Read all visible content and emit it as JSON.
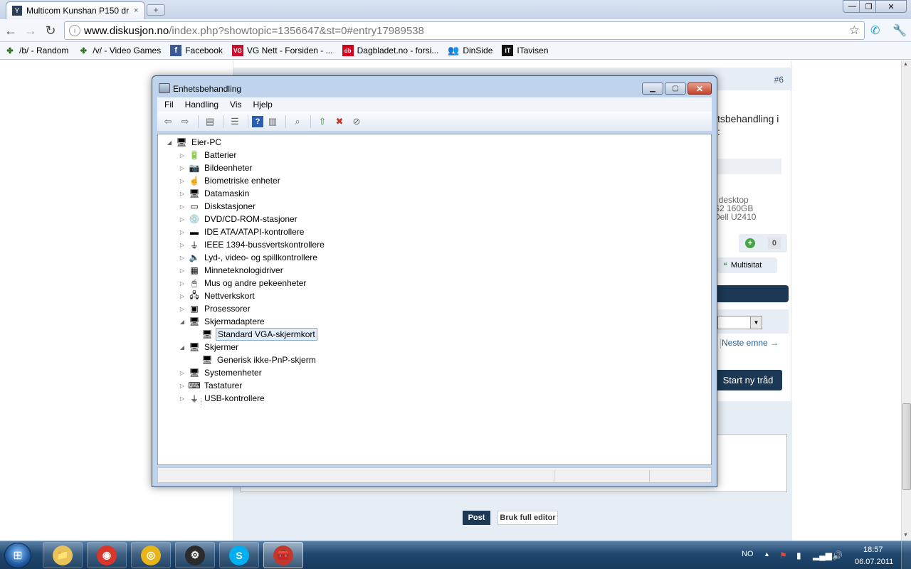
{
  "browser": {
    "tab": {
      "title": "Multicom Kunshan P150 dr",
      "close": "×"
    },
    "new_tab": "+",
    "window_controls": {
      "min": "—",
      "max": "❐",
      "close": "✕"
    },
    "nav": {
      "back": "←",
      "forward": "→",
      "reload": "↻"
    },
    "url": {
      "host": "www.diskusjon.no",
      "path": "/index.php?showtopic=1356647&st=0#entry17989538"
    },
    "bookmarks": [
      {
        "label": "/b/ - Random",
        "icon": "clover-icon",
        "color": "#2e6b1e"
      },
      {
        "label": "/v/ - Video Games",
        "icon": "clover-icon",
        "color": "#2e6b1e"
      },
      {
        "label": "Facebook",
        "icon": "facebook-icon",
        "color": "#3b5998"
      },
      {
        "label": "VG Nett - Forsiden - ...",
        "icon": "vg-icon",
        "color": "#c8102e"
      },
      {
        "label": "Dagbladet.no - forsi...",
        "icon": "db-icon",
        "color": "#d6001c"
      },
      {
        "label": "DinSide",
        "icon": "dinside-icon",
        "color": "#2266aa"
      },
      {
        "label": "ITavisen",
        "icon": "itavisen-icon",
        "color": "#111111"
      }
    ]
  },
  "forum": {
    "post_number": "#6",
    "post_text_line1": "tsbehandling i",
    "post_text_line2": ":",
    "specs": [
      ", desktop",
      "S2 160GB",
      "Dell U2410"
    ],
    "rep_count": "0",
    "multiquote_label": "Multisitat",
    "next_topic": "Neste emne →",
    "start_thread": "Start ny tråd",
    "post_button": "Post",
    "full_editor_button": "Bruk full editor"
  },
  "device_manager": {
    "title": "Enhetsbehandling",
    "menus": [
      "Fil",
      "Handling",
      "Vis",
      "Hjelp"
    ],
    "root": "Eier-PC",
    "categories": [
      {
        "label": "Batterier",
        "icon": "battery-icon",
        "glyph": "🔋"
      },
      {
        "label": "Bildeenheter",
        "icon": "camera-icon",
        "glyph": "📷"
      },
      {
        "label": "Biometriske enheter",
        "icon": "fingerprint-icon",
        "glyph": "☝"
      },
      {
        "label": "Datamaskin",
        "icon": "computer-icon",
        "glyph": "🖥"
      },
      {
        "label": "Diskstasjoner",
        "icon": "disk-drive-icon",
        "glyph": "▭"
      },
      {
        "label": "DVD/CD-ROM-stasjoner",
        "icon": "dvd-drive-icon",
        "glyph": "💿"
      },
      {
        "label": "IDE ATA/ATAPI-kontrollere",
        "icon": "ide-controller-icon",
        "glyph": "▬"
      },
      {
        "label": "IEEE 1394-bussvertskontrollere",
        "icon": "firewire-icon",
        "glyph": "⏚"
      },
      {
        "label": "Lyd-, video- og spillkontrollere",
        "icon": "speaker-icon",
        "glyph": "🔈"
      },
      {
        "label": "Minneteknologidriver",
        "icon": "memory-icon",
        "glyph": "▦"
      },
      {
        "label": "Mus og andre pekeenheter",
        "icon": "mouse-icon",
        "glyph": "🖱"
      },
      {
        "label": "Nettverkskort",
        "icon": "network-icon",
        "glyph": "🖧"
      },
      {
        "label": "Prosessorer",
        "icon": "cpu-icon",
        "glyph": "▣"
      },
      {
        "label": "Skjermadaptere",
        "icon": "display-adapter-icon",
        "glyph": "🖥",
        "expanded": true,
        "children": [
          {
            "label": "Standard VGA-skjermkort",
            "selected": true
          }
        ]
      },
      {
        "label": "Skjermer",
        "icon": "monitor-icon",
        "glyph": "🖥",
        "expanded": true,
        "children": [
          {
            "label": "Generisk ikke-PnP-skjerm"
          }
        ]
      },
      {
        "label": "Systemenheter",
        "icon": "system-devices-icon",
        "glyph": "🖥"
      },
      {
        "label": "Tastaturer",
        "icon": "keyboard-icon",
        "glyph": "⌨"
      },
      {
        "label": "USB-kontrollere",
        "icon": "usb-icon",
        "glyph": "⏚"
      }
    ]
  },
  "taskbar": {
    "apps": [
      {
        "name": "explorer",
        "icon": "folder-icon",
        "glyph": "📁",
        "color": "#e8c35a"
      },
      {
        "name": "chrome",
        "icon": "chrome-icon",
        "glyph": "◉",
        "color": "#d8362a"
      },
      {
        "name": "media",
        "icon": "disc-icon",
        "glyph": "◎",
        "color": "#e7b51a"
      },
      {
        "name": "steam",
        "icon": "steam-icon",
        "glyph": "⚙",
        "color": "#2b2b2b"
      },
      {
        "name": "skype",
        "icon": "skype-icon",
        "glyph": "S",
        "color": "#00aff0"
      },
      {
        "name": "device-manager",
        "icon": "toolbox-icon",
        "glyph": "🧰",
        "color": "#c0392b",
        "active": true
      }
    ],
    "language": "NO",
    "time": "18:57",
    "date": "06.07.2011"
  }
}
